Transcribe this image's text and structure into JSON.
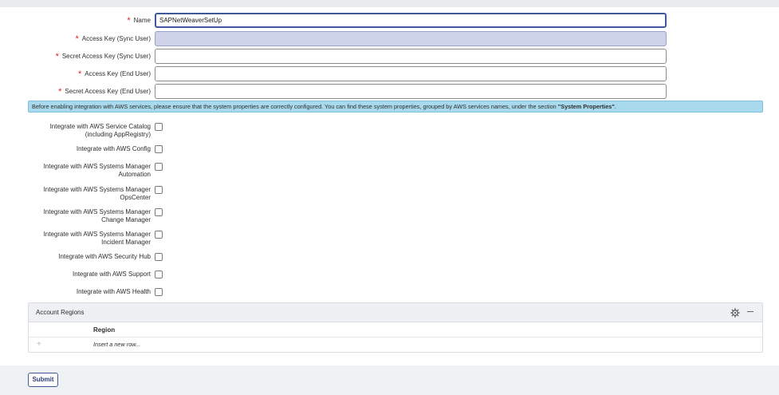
{
  "form": {
    "fields": [
      {
        "label": "Name",
        "value": "SAPNetWeaverSetUp",
        "required": "*"
      },
      {
        "label": "Access Key (Sync User)",
        "value": "",
        "required": "*"
      },
      {
        "label": "Secret Access Key (Sync User)",
        "value": "",
        "required": "*"
      },
      {
        "label": "Access Key (End User)",
        "value": "",
        "required": "*"
      },
      {
        "label": "Secret Access Key (End User)",
        "value": "",
        "required": "*"
      }
    ],
    "info_banner": {
      "text": "Before enabling integration with AWS services, please ensure that the system properties are correctly configured. You can find these system properties, grouped by AWS services names, under the section ",
      "bold": "\"System Properties\"",
      "end": "."
    },
    "integrations": [
      {
        "line1": "Integrate with AWS Service Catalog",
        "line2": "(including AppRegistry)"
      },
      {
        "line1": "Integrate with AWS Config",
        "line2": ""
      },
      {
        "line1": "Integrate with AWS Systems Manager",
        "line2": "Automation"
      },
      {
        "line1": "Integrate with AWS Systems Manager",
        "line2": "OpsCenter"
      },
      {
        "line1": "Integrate with AWS Systems Manager",
        "line2": "Change Manager"
      },
      {
        "line1": "Integrate with AWS Systems Manager",
        "line2": "Incident Manager"
      },
      {
        "line1": "Integrate with AWS Security Hub",
        "line2": ""
      },
      {
        "line1": "Integrate with AWS Support",
        "line2": ""
      },
      {
        "line1": "Integrate with AWS Health",
        "line2": ""
      }
    ]
  },
  "related_list": {
    "title": "Account Regions",
    "column": "Region",
    "insert_plus": "+",
    "insert_label": "Insert a new row..."
  },
  "footer": {
    "submit_label": "Submit"
  },
  "colors": {
    "required": "#d9262c",
    "accent": "#3f5a9b",
    "banner": "#a9d9ec",
    "filled_input": "#cfd3ea"
  }
}
